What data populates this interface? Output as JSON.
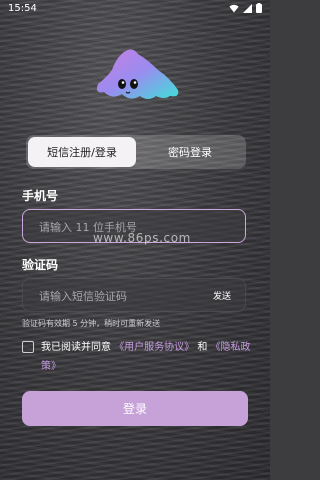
{
  "status_bar": {
    "time": "15:54"
  },
  "tabs": {
    "sms": "短信注册/登录",
    "password": "密码登录"
  },
  "phone": {
    "label": "手机号",
    "placeholder": "请输入 11 位手机号"
  },
  "code": {
    "label": "验证码",
    "placeholder": "请输入短信验证码",
    "send": "发送"
  },
  "hint": "验证码有效期 5 分钟，稍时可重新发送",
  "agreement": {
    "prefix": "我已阅读并同意",
    "terms": "《用户服务协议》",
    "and": "和",
    "privacy": "《隐私政策》"
  },
  "login_button": "登录",
  "watermark": "www.86ps.com",
  "colors": {
    "accent": "#c7a2d9",
    "link": "#c79be0",
    "input_focus_border": "#c9a6dc"
  },
  "icons": [
    "wifi-icon",
    "signal-icon",
    "battery-icon",
    "mascot-logo",
    "checkbox-icon"
  ]
}
